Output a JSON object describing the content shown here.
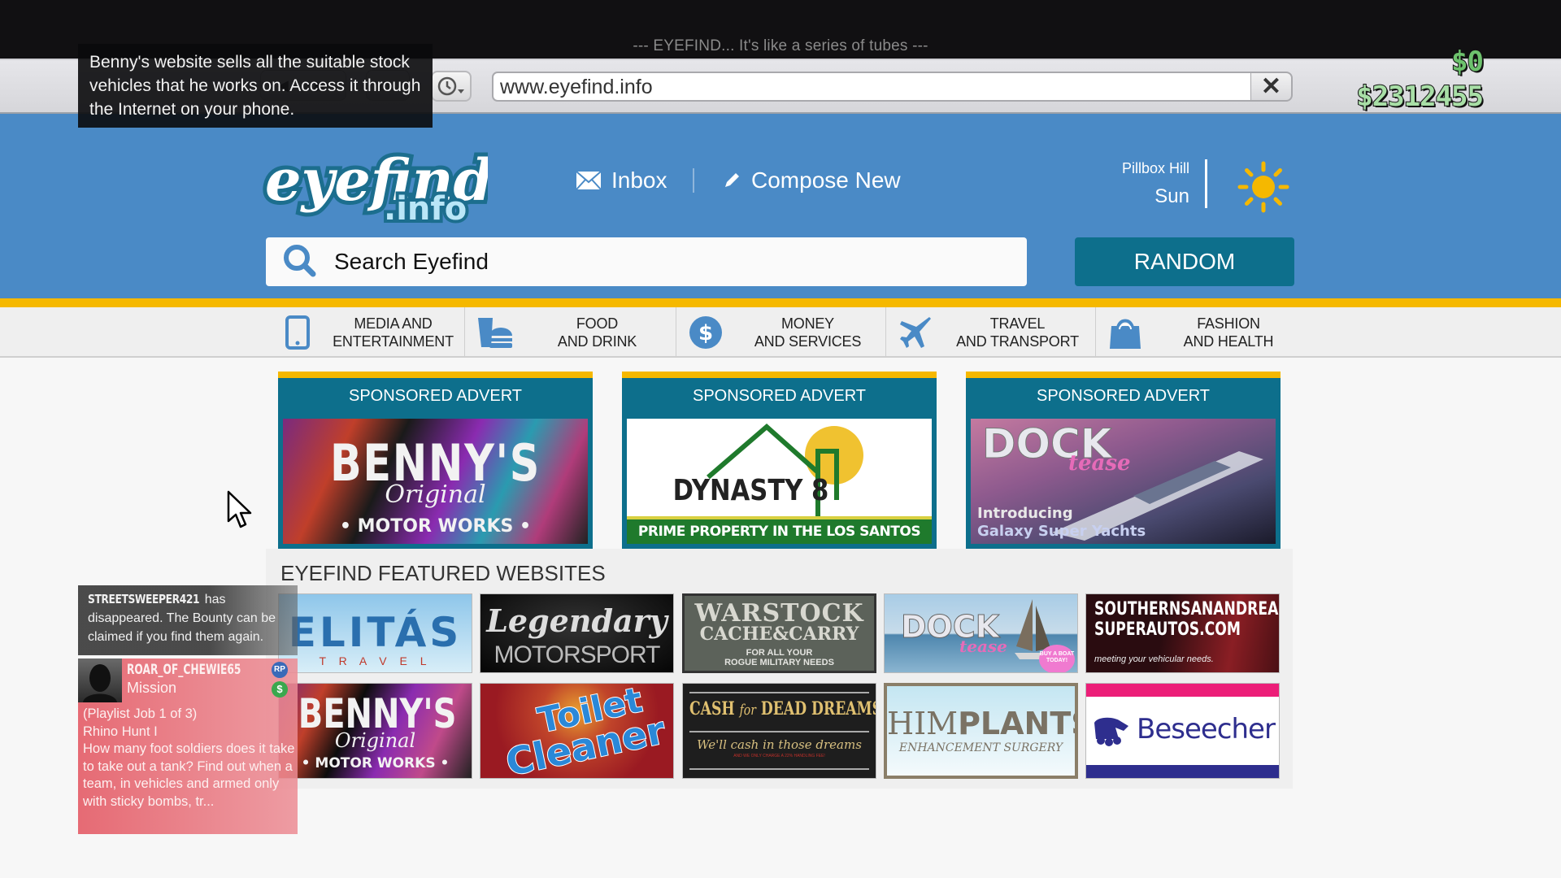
{
  "tagline": "--- EYEFIND... It's like a series of tubes ---",
  "browser": {
    "url": "www.eyefind.info",
    "close_icon": "close-icon",
    "history_icon": "clock-icon"
  },
  "hud": {
    "cash": "$0",
    "bank": "$2312455",
    "cash_color": "#6dc26d",
    "bank_color": "#a8dfa6"
  },
  "tooltip": {
    "text": "Benny's website sells all the suitable stock vehicles that he works on. Access it through the Internet on your phone."
  },
  "header": {
    "logo_main": "eyefind",
    "logo_sub": ".info",
    "inbox_label": "Inbox",
    "compose_label": "Compose New",
    "location": "Pillbox Hill",
    "weather": "Sun",
    "weather_icon": "sun-icon",
    "search_placeholder": "Search Eyefind",
    "random_label": "RANDOM",
    "colors": {
      "header_bg": "#4a8ac6",
      "accent": "#0d6f8c",
      "stripe": "#f5b800"
    }
  },
  "categories": [
    {
      "line1": "MEDIA AND",
      "line2": "ENTERTAINMENT",
      "icon": "phone-icon"
    },
    {
      "line1": "FOOD",
      "line2": "AND DRINK",
      "icon": "food-icon"
    },
    {
      "line1": "MONEY",
      "line2": "AND SERVICES",
      "icon": "dollar-icon"
    },
    {
      "line1": "TRAVEL",
      "line2": "AND TRANSPORT",
      "icon": "airplane-icon"
    },
    {
      "line1": "FASHION",
      "line2": "AND HEALTH",
      "icon": "shopping-bag-icon"
    }
  ],
  "adverts": [
    {
      "heading": "SPONSORED ADVERT",
      "title": "BENNY'S",
      "script": "Original",
      "subtitle": "• MOTOR WORKS •"
    },
    {
      "heading": "SPONSORED ADVERT",
      "title": "DYNASTY 8",
      "subtitle": "PRIME PROPERTY IN THE LOS SANTOS AREA"
    },
    {
      "heading": "SPONSORED ADVERT",
      "title": "DOCK",
      "script": "tease",
      "caption1": "Introducing",
      "caption2": "Galaxy Super Yachts"
    }
  ],
  "featured": {
    "title": "EYEFIND FEATURED WEBSITES",
    "sites": [
      {
        "name": "ELITÁS",
        "sub": "T R A V E L"
      },
      {
        "name": "Legendary",
        "sub": "MOTORSPORT"
      },
      {
        "name": "WARSTOCK",
        "name2": "CACHE&CARRY",
        "sub": "FOR ALL YOUR",
        "sub2": "ROGUE MILITARY NEEDS"
      },
      {
        "name": "DOCK",
        "script": "tease",
        "badge": "BUY A BOAT TODAY!"
      },
      {
        "name": "SOUTHERNSANANDREAS",
        "name2": "SUPERAUTOS.COM",
        "sub": "meeting your vehicular needs."
      },
      {
        "name": "BENNY'S",
        "script": "Original",
        "sub": "• MOTOR WORKS •"
      },
      {
        "name": "Toilet",
        "name2": "Cleaner"
      },
      {
        "name": "CASH",
        "script": "for",
        "name2": "DEAD DREAMS",
        "sub": "We'll cash in those dreams",
        "sub2": "AND WE ONLY CHARGE A 22% HANDLING FEE!"
      },
      {
        "name": "HIM",
        "name2": "PLANTS",
        "sub": "ENHANCEMENT SURGERY"
      },
      {
        "name": "Beseecher"
      }
    ]
  },
  "notifications": {
    "bounty": {
      "player": "STREETSWEEPER421",
      "text": " has disappeared. The Bounty can be claimed if you find them again."
    },
    "mission": {
      "player": "ROAR_OF_CHEWIE65",
      "type": "Mission",
      "badge_rp": "RP",
      "badge_cash": "$",
      "body": "(Playlist Job 1 of 3)\nRhino Hunt I\nHow many foot soldiers does it take to take out a tank? Find out when a team, in vehicles and armed only with sticky bombs, tr..."
    }
  }
}
